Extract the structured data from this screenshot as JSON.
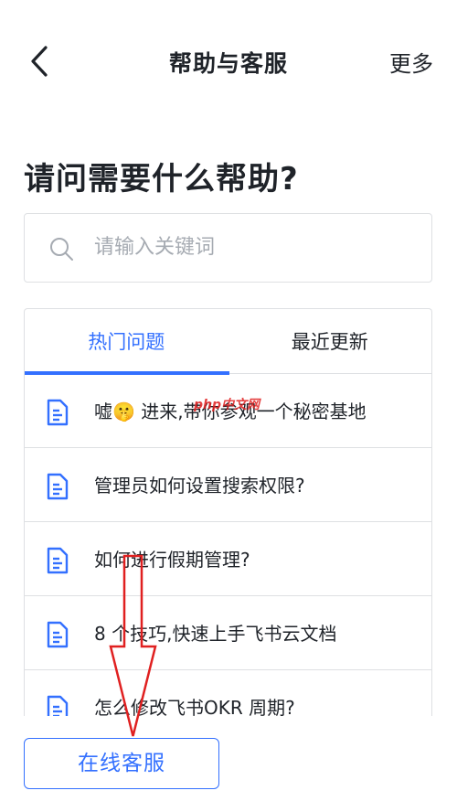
{
  "nav": {
    "title": "帮助与客服",
    "more": "更多"
  },
  "page_title": "请问需要什么帮助?",
  "search": {
    "placeholder": "请输入关键词",
    "value": ""
  },
  "tabs": [
    {
      "label": "热门问题",
      "active": true
    },
    {
      "label": "最近更新",
      "active": false
    }
  ],
  "questions": [
    {
      "text": "嘘🤫 进来,带你参观一个秘密基地"
    },
    {
      "text": "管理员如何设置搜索权限?"
    },
    {
      "text": "如何进行假期管理?"
    },
    {
      "text": "8 个技巧,快速上手飞书云文档"
    },
    {
      "text": "怎么修改飞书OKR 周期?"
    }
  ],
  "online_service_button": "在线客服",
  "watermark": "php中文网",
  "colors": {
    "accent": "#3370ff",
    "arrow": "#e02020",
    "border": "#dee0e3",
    "placeholder": "#a6abb2"
  },
  "icons": {
    "back": "chevron-left-icon",
    "search": "search-icon",
    "doc": "document-icon"
  }
}
